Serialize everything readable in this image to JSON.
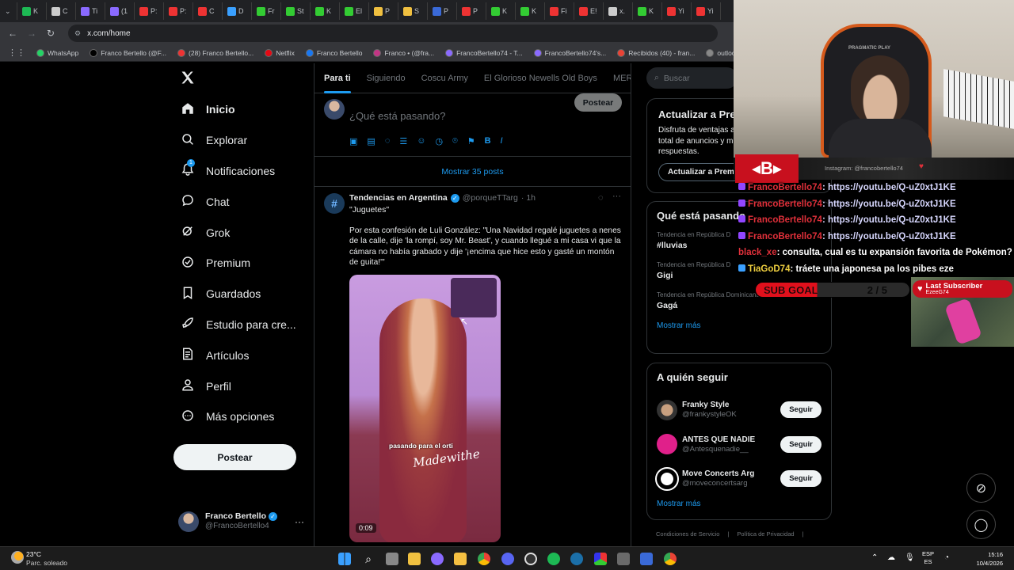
{
  "browser": {
    "tabs": [
      "K",
      "C",
      "Ti",
      "(1",
      "P:",
      "P:",
      "C",
      "D",
      "Fr",
      "St",
      "K",
      "El",
      "P",
      "S",
      "P",
      "P",
      "K",
      "K",
      "Fi",
      "E!",
      "x.",
      "K",
      "Yi",
      "Yi"
    ],
    "url": "x.com/home",
    "bookmarks": [
      "WhatsApp",
      "Franco Bertello (@F...",
      "(28) Franco Bertello...",
      "Netflix",
      "Franco Bertello",
      "Franco • (@fra...",
      "FrancoBertello74 - T...",
      "FrancoBertello74's...",
      "Recibidos (40) - fran...",
      "outlook",
      "Aler"
    ]
  },
  "nav": {
    "items": [
      "Inicio",
      "Explorar",
      "Notificaciones",
      "Chat",
      "Grok",
      "Premium",
      "Guardados",
      "Estudio para cre...",
      "Artículos",
      "Perfil",
      "Más opciones"
    ],
    "notif_badge": "1",
    "post_button": "Postear",
    "user_name": "Franco Bertello",
    "user_handle": "@FrancoBertello4",
    "more": "···"
  },
  "feed": {
    "tabs": [
      "Para ti",
      "Siguiendo",
      "Coscu Army",
      "El Glorioso Newells Old Boys",
      "MERNC"
    ],
    "compose_placeholder": "¿Qué está pasando?",
    "compose_button": "Postear",
    "show_posts": "Mostrar 35 posts",
    "post": {
      "author": "Tendencias en Argentina",
      "handle": "@porqueTTarg",
      "time": "· 1h",
      "title": "\"Juguetes\"",
      "text": "Por esta confesión de Luli González: \"Una Navidad regalé juguetes a nenes de la calle, dije 'la rompí, soy Mr. Beast', y cuando llegué a mi casa vi que la cámara no había grabado y dije '¡encima que hice esto y gasté un montón de guita!'\"",
      "video_caption_1": "pasando para el orti",
      "video_caption_2": "Madewithe",
      "duration": "0:09",
      "more": "···"
    }
  },
  "sidebar": {
    "search_placeholder": "Buscar",
    "premium": {
      "title": "Actualizar a Pre",
      "text": "Disfruta de ventajas a total de anuncios y m respuestas.",
      "button": "Actualizar a Prem"
    },
    "trends_title": "Qué está pasando",
    "trends": [
      {
        "context": "Tendencia en República D",
        "name": "#lluvias"
      },
      {
        "context": "Tendencia en República D",
        "name": "Gigi"
      },
      {
        "context": "Tendencia en República Dominicana",
        "name": "Gagá"
      }
    ],
    "show_more": "Mostrar más",
    "who_title": "A quién seguir",
    "who": [
      {
        "name": "Franky Style",
        "handle": "@frankystyleOK",
        "button": "Seguir"
      },
      {
        "name": "ANTES QUE NADIE",
        "handle": "@Antesquenadie__",
        "button": "Seguir"
      },
      {
        "name": "Move Concerts Arg",
        "handle": "@moveconcertsarg",
        "button": "Seguir"
      }
    ],
    "show_more_2": "Mostrar más",
    "footer_1": "Condiciones de Servicio",
    "footer_2": "Política de Privacidad"
  },
  "stream": {
    "instagram": "Instagram: @francobertello74",
    "chat": [
      {
        "user": "FrancoBertello74",
        "msg": ": https://youtu.be/Q-uZ0xtJ1KE"
      },
      {
        "user": "FrancoBertello74",
        "msg": ": https://youtu.be/Q-uZ0xtJ1KE"
      },
      {
        "user": "FrancoBertello74",
        "msg": ": https://youtu.be/Q-uZ0xtJ1KE"
      },
      {
        "user": "FrancoBertello74",
        "msg": ": https://youtu.be/Q-uZ0xtJ1KE"
      },
      {
        "user": "black_xe",
        "msg": ": consulta, cual es tu expansión favorita de Pokémon?"
      },
      {
        "user": "TiaGoD74",
        "msg": ": tráete una japonesa pa los pibes eze"
      }
    ],
    "sub_goal_label": "SUB GOAL",
    "sub_goal_value": "2 / 5",
    "last_sub_label": "Last Subscriber",
    "last_sub_name": "EzeeG74",
    "chair_brand": "PRAGMATIC PLAY"
  },
  "taskbar": {
    "temp": "23°C",
    "weather": "Parc. soleado",
    "lang_1": "ESP",
    "lang_2": "ES",
    "time": "15:16",
    "date": "10/4/2026"
  }
}
